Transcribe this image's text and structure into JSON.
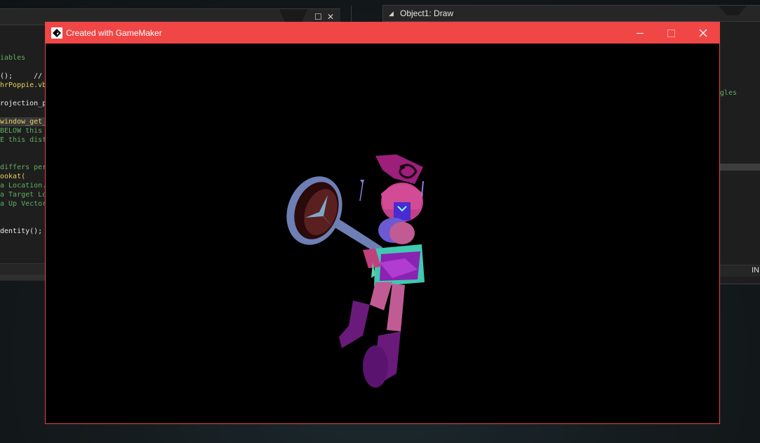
{
  "background_ide": {
    "left_panel": {
      "code_lines": [
        {
          "text": "iables",
          "style": "green"
        },
        {
          "text": "",
          "style": "white"
        },
        {
          "text": "();     //",
          "style": "white"
        },
        {
          "text": "hrPoppie.vb",
          "style": "yellow"
        },
        {
          "text": "",
          "style": "white"
        },
        {
          "text": "rojection_p",
          "style": "white"
        },
        {
          "text": "",
          "style": "white"
        },
        {
          "text": "window_get_",
          "style": "highlight"
        },
        {
          "text": "BELOW this",
          "style": "green"
        },
        {
          "text": "E this dist",
          "style": "green"
        },
        {
          "text": "",
          "style": "white"
        },
        {
          "text": "",
          "style": "white"
        },
        {
          "text": "differs per",
          "style": "green"
        },
        {
          "text": "ookat(",
          "style": "yellow"
        },
        {
          "text": "a Location.",
          "style": "green"
        },
        {
          "text": "a Target Lo",
          "style": "green"
        },
        {
          "text": "a Up Vector",
          "style": "green"
        },
        {
          "text": "",
          "style": "white"
        },
        {
          "text": "",
          "style": "white"
        },
        {
          "text": "dentity();",
          "style": "white"
        }
      ]
    },
    "right_panel": {
      "title": "Object1: Draw",
      "code_fragment": "gles",
      "status_text": "IN"
    }
  },
  "game_window": {
    "title": "Created with GameMaker",
    "icon": "gamemaker-logo-icon",
    "titlebar_color": "#f04646",
    "controls": {
      "minimize_icon": "minimize-icon",
      "maximize_icon": "maximize-icon",
      "close_icon": "close-icon"
    },
    "canvas_background": "#000000"
  }
}
